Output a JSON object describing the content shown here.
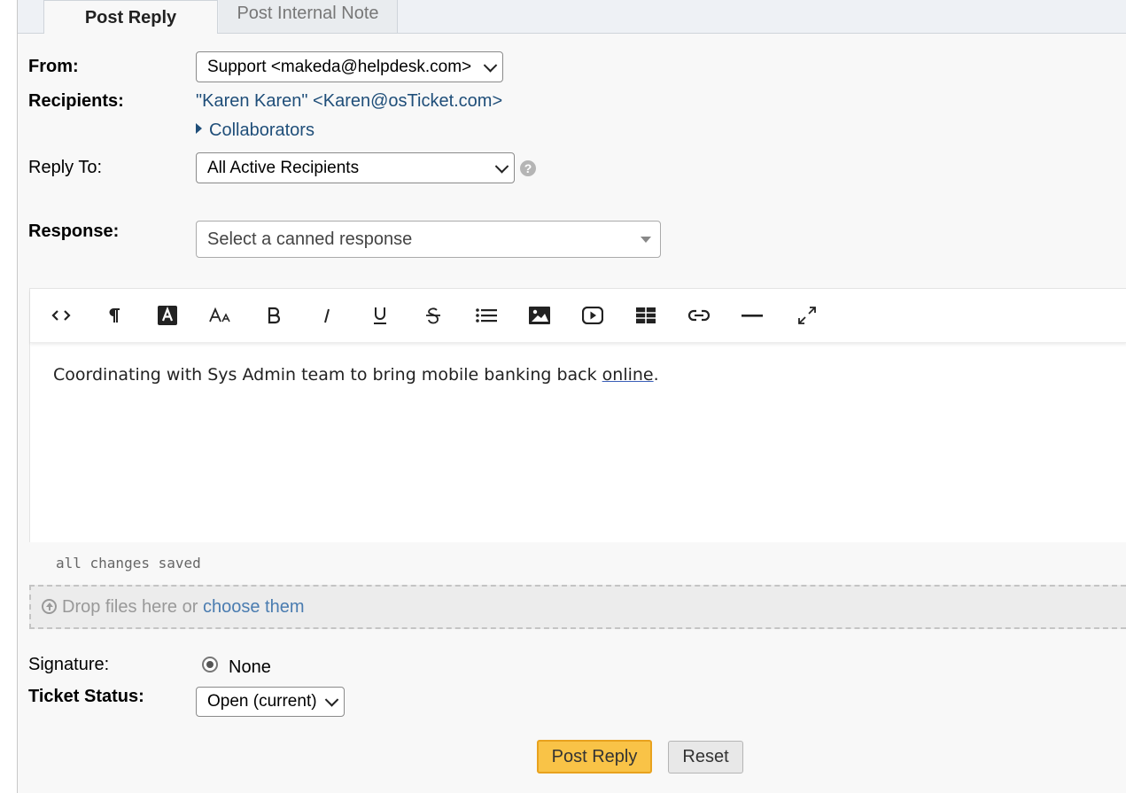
{
  "tabs": [
    {
      "label": "Post Reply",
      "active": true
    },
    {
      "label": "Post Internal Note",
      "active": false
    }
  ],
  "form": {
    "from": {
      "label": "From:",
      "value": "Support <makeda@helpdesk.com>"
    },
    "recipients": {
      "label": "Recipients:",
      "value": "\"Karen Karen\" <Karen@osTicket.com>",
      "collaborators": "Collaborators"
    },
    "reply_to": {
      "label": "Reply To:",
      "value": "All Active Recipients",
      "help": "?"
    },
    "response": {
      "label": "Response:",
      "placeholder": "Select a canned response"
    },
    "signature": {
      "label": "Signature:",
      "value": "None"
    },
    "ticket_status": {
      "label": "Ticket Status:",
      "value": "Open (current)"
    }
  },
  "editor": {
    "toolbar": [
      "code-view",
      "paragraph",
      "text-color",
      "font-size",
      "bold",
      "italic",
      "underline",
      "strikethrough",
      "list",
      "image",
      "video",
      "table",
      "link",
      "horizontal-rule",
      "fullscreen"
    ],
    "content_main": "Coordinating with Sys Admin team to bring mobile banking back ",
    "content_link": "online",
    "content_end": ".",
    "status": "all changes saved"
  },
  "dropzone": {
    "text": "Drop files here or ",
    "link": "choose them"
  },
  "buttons": {
    "submit": "Post Reply",
    "reset": "Reset"
  },
  "colors": {
    "accent": "#f9c347",
    "link": "#1f4e79"
  }
}
